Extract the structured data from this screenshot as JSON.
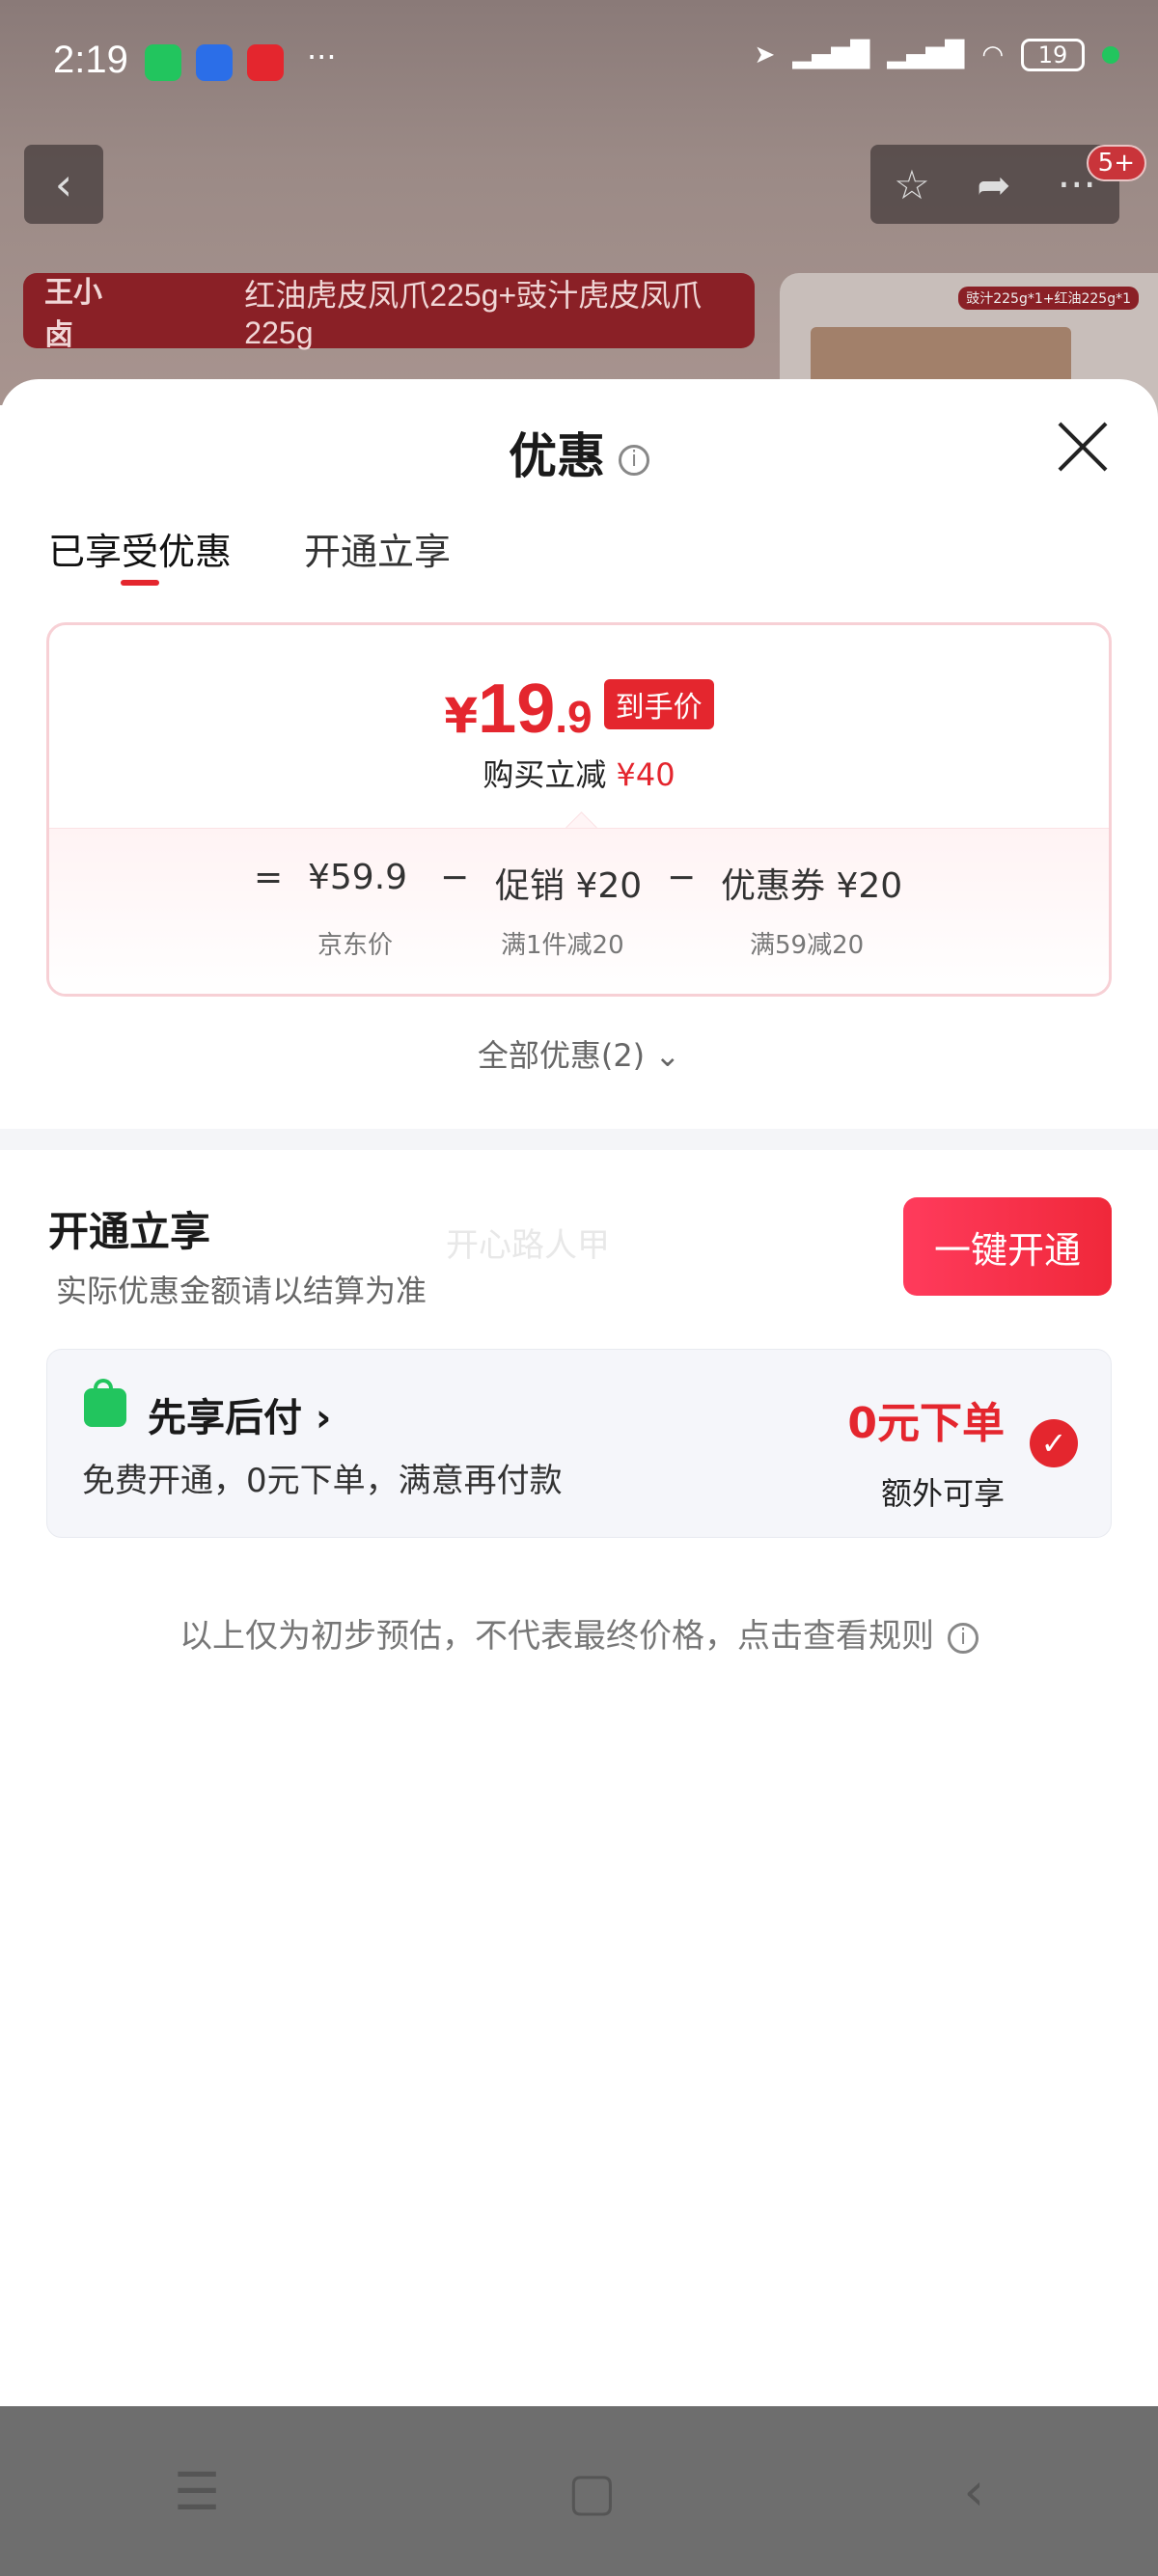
{
  "status_bar": {
    "time": "2:19",
    "battery": "19",
    "more": "···"
  },
  "top_bar": {
    "back_icon": "‹",
    "star_icon": "☆",
    "share_icon": "➦",
    "more_icon": "···",
    "badge": "5+"
  },
  "banner": {
    "logo": "王小卤",
    "text": "红油虎皮凤爪225g+豉汁虎皮凤爪225g"
  },
  "product_tag": "豉汁225g*1+红油225g*1",
  "sheet": {
    "title": "优惠",
    "info_icon": "i"
  },
  "tabs": [
    {
      "label": "已享受优惠"
    },
    {
      "label": "开通立享"
    }
  ],
  "price_card": {
    "currency": "¥",
    "price_int": "19",
    "price_dec": ".9",
    "tag": "到手价",
    "reduce_label": "购买立减",
    "reduce_value": "¥40",
    "formula": {
      "equals": "=",
      "minus": "−",
      "base": "¥59.9",
      "base_label": "京东价",
      "promo": "促销 ¥20",
      "promo_label": "满1件减20",
      "coupon": "优惠券 ¥20",
      "coupon_label": "满59减20"
    }
  },
  "all_discounts": "全部优惠(2)",
  "open_section": {
    "title": "开通立享",
    "subtitle": "实际优惠金额请以结算为准",
    "watermark": "开心路人甲",
    "button": "一键开通"
  },
  "pay_later": {
    "title": "先享后付 ›",
    "desc": "免费开通，0元下单，满意再付款",
    "highlight": "0元下单",
    "extra": "额外可享",
    "check": "✓"
  },
  "footnote": "以上仅为初步预估，不代表最终价格，点击查看规则",
  "nav": {
    "menu_icon": "☰",
    "home_icon": "▢",
    "back_icon": "‹"
  },
  "colors": {
    "accent": "#e4262e",
    "green": "#22c55e",
    "card_bg": "#f5f6fa"
  }
}
